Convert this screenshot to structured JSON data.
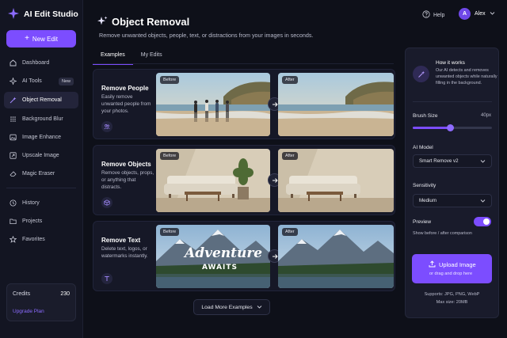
{
  "app": {
    "title": "AI Edit Studio",
    "new_edit_label": "New Edit"
  },
  "sidebar": {
    "items": [
      {
        "label": "Dashboard",
        "icon": "home-icon"
      },
      {
        "label": "AI Tools",
        "icon": "sparkle-icon",
        "badge": "New"
      },
      {
        "label": "Object Removal",
        "icon": "magic-wand-icon",
        "active": true
      },
      {
        "label": "Background Blur",
        "icon": "blur-icon"
      },
      {
        "label": "Image Enhance",
        "icon": "image-icon"
      },
      {
        "label": "Upscale Image",
        "icon": "upscale-icon"
      },
      {
        "label": "Magic Eraser",
        "icon": "eraser-icon"
      },
      {
        "label": "History",
        "icon": "clock-icon"
      },
      {
        "label": "Projects",
        "icon": "folder-icon"
      },
      {
        "label": "Favorites",
        "icon": "star-icon"
      }
    ],
    "credits": {
      "label": "Credits",
      "value": "230",
      "upgrade_label": "Upgrade Plan"
    }
  },
  "header": {
    "title": "Object Removal",
    "subtitle": "Remove unwanted objects, people, text, or distractions from your images in seconds.",
    "help_label": "Help",
    "user_name": "Alex",
    "user_initial": "A"
  },
  "tabs": [
    {
      "label": "Examples",
      "active": true
    },
    {
      "label": "My Edits",
      "active": false
    }
  ],
  "examples": [
    {
      "title": "Remove People",
      "description": "Easily remove unwanted people from your photos.",
      "before_label": "Before",
      "after_label": "After",
      "icon": "people-icon"
    },
    {
      "title": "Remove Objects",
      "description": "Remove objects, props, or anything that distracts.",
      "before_label": "Before",
      "after_label": "After",
      "icon": "cube-icon"
    },
    {
      "title": "Remove Text",
      "description": "Delete text, logos, or watermarks instantly.",
      "before_label": "Before",
      "after_label": "After",
      "icon": "text-icon",
      "overlay_text_1": "Adventure",
      "overlay_text_2": "AWAITS"
    }
  ],
  "load_more_label": "Load More Examples",
  "panel": {
    "how_title": "How it works",
    "how_text": "Our AI detects and removes unwanted objects while naturally filling in the background.",
    "brush_label": "Brush Size",
    "brush_value": "40px",
    "brush_level": 0.47,
    "model_label": "AI Model",
    "model_value": "Smart Remove v2",
    "sensitivity_label": "Sensitivity",
    "sensitivity_value": "Medium",
    "preview_label": "Preview",
    "preview_sub": "Show before / after comparison",
    "preview_on": true,
    "upload_title": "Upload Image",
    "upload_sub": "or drag and drop here",
    "supports_1": "Supports: JPG, PNG, WebP",
    "supports_2": "Max size: 20MB"
  },
  "colors": {
    "accent": "#7c4dff",
    "background": "#0e1019",
    "sidebar": "#131522",
    "card": "#161827"
  }
}
